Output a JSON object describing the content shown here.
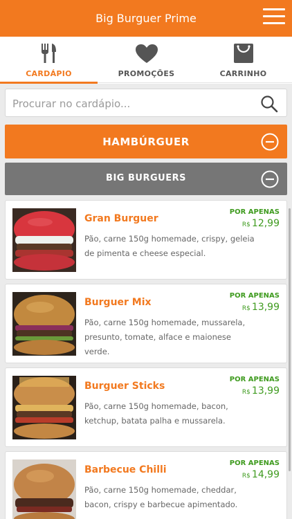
{
  "app": {
    "title": "Big Burguer Prime",
    "accent": "#f2791f",
    "price_color": "#3f9b1f"
  },
  "header": {
    "menu_icon": "hamburger-menu-icon"
  },
  "tabs": [
    {
      "label": "CARDÁPIO",
      "icon": "fork-knife-icon",
      "active": true
    },
    {
      "label": "PROMOÇÕES",
      "icon": "heart-icon",
      "active": false
    },
    {
      "label": "CARRINHO",
      "icon": "shopping-bag-icon",
      "active": false
    }
  ],
  "search": {
    "placeholder": "Procurar no cardápio...",
    "value": ""
  },
  "category": {
    "label": "HAMBÚRGUER",
    "icon": "collapse-minus-icon"
  },
  "subcategory": {
    "label": "BIG BURGUERS",
    "icon": "collapse-minus-icon"
  },
  "items": [
    {
      "name": "Gran Burguer",
      "desc": "Pão, carne 150g homemade, crispy, geleia de pimenta e cheese especial.",
      "price_label": "POR APENAS",
      "currency": "R$",
      "price": "12,99"
    },
    {
      "name": "Burguer Mix",
      "desc": "Pão, carne 150g homemade, mussarela, presunto, tomate, alface e maionese verde.",
      "price_label": "POR APENAS",
      "currency": "R$",
      "price": "13,99"
    },
    {
      "name": "Burguer Sticks",
      "desc": "Pão, carne 150g homemade, bacon, ketchup, batata palha e mussarela.",
      "price_label": "POR APENAS",
      "currency": "R$",
      "price": "13,99"
    },
    {
      "name": "Barbecue Chilli",
      "desc": "Pão, carne 150g homemade, cheddar, bacon, crispy e barbecue apimentado.",
      "price_label": "POR APENAS",
      "currency": "R$",
      "price": "14,99"
    }
  ]
}
